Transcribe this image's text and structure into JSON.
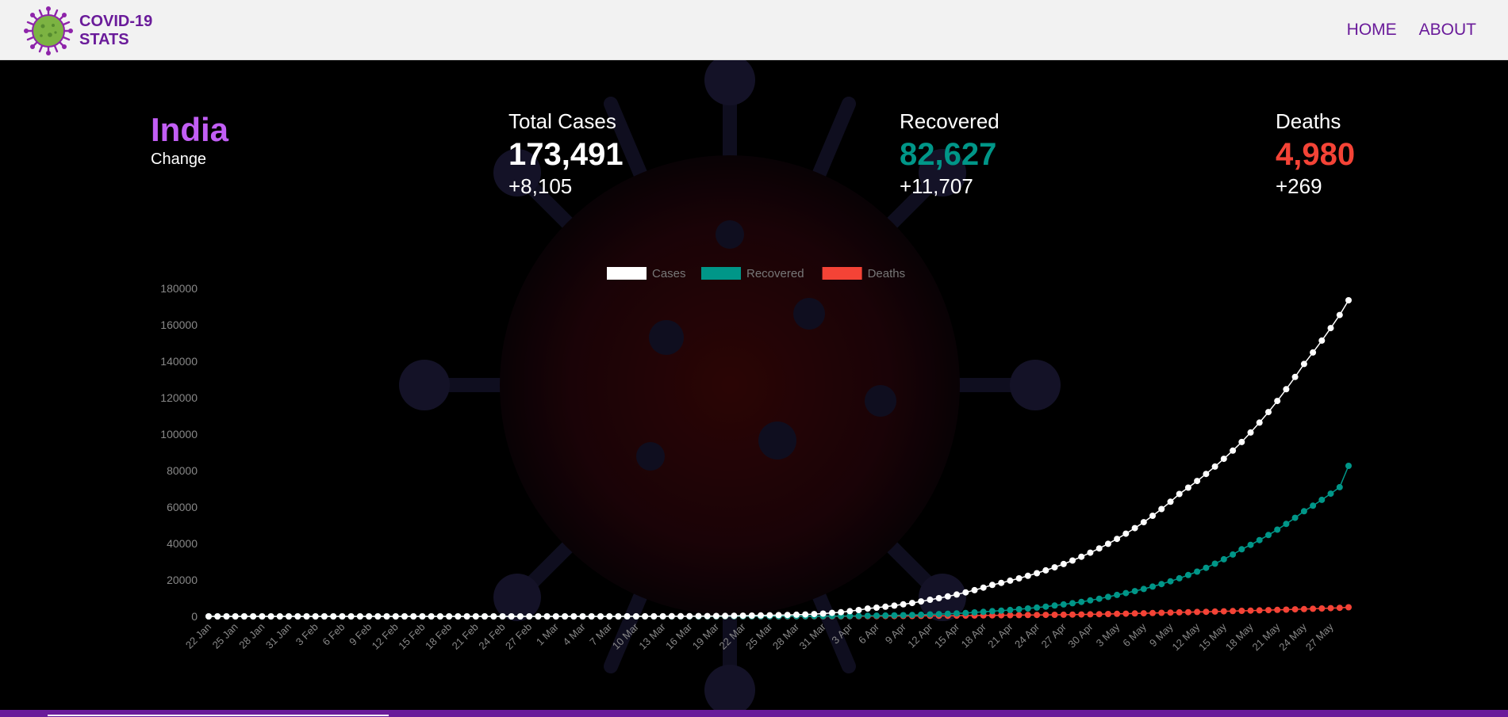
{
  "brand": {
    "line1": "COVID-19",
    "line2": "STATS"
  },
  "nav": {
    "home": "HOME",
    "about": "ABOUT"
  },
  "country": {
    "name": "India",
    "change_label": "Change"
  },
  "stats": {
    "cases": {
      "label": "Total Cases",
      "value": "173,491",
      "delta": "+8,105"
    },
    "recovered": {
      "label": "Recovered",
      "value": "82,627",
      "delta": "+11,707"
    },
    "deaths": {
      "label": "Deaths",
      "value": "4,980",
      "delta": "+269"
    }
  },
  "colors": {
    "brand": "#6a1b9a",
    "country": "#c25ef5",
    "cases": "#ffffff",
    "recovered": "#009688",
    "deaths": "#f44336"
  },
  "chart_data": {
    "type": "line",
    "legend_position": "top",
    "ylim": [
      0,
      180000
    ],
    "yticks": [
      0,
      20000,
      40000,
      60000,
      80000,
      100000,
      120000,
      140000,
      160000,
      180000
    ],
    "x_start": "2020-01-22",
    "x_end": "2020-05-29",
    "xtick_labels": [
      "22 Jan",
      "25 Jan",
      "28 Jan",
      "31 Jan",
      "3 Feb",
      "6 Feb",
      "9 Feb",
      "12 Feb",
      "15 Feb",
      "18 Feb",
      "21 Feb",
      "24 Feb",
      "27 Feb",
      "1 Mar",
      "4 Mar",
      "7 Mar",
      "10 Mar",
      "13 Mar",
      "16 Mar",
      "19 Mar",
      "22 Mar",
      "25 Mar",
      "28 Mar",
      "31 Mar",
      "3 Apr",
      "6 Apr",
      "9 Apr",
      "12 Apr",
      "15 Apr",
      "18 Apr",
      "21 Apr",
      "24 Apr",
      "27 Apr",
      "30 Apr",
      "3 May",
      "6 May",
      "9 May",
      "12 May",
      "15 May",
      "18 May",
      "21 May",
      "24 May",
      "27 May"
    ],
    "series": [
      {
        "name": "Cases",
        "color": "#ffffff",
        "points": [
          [
            "2020-01-22",
            0
          ],
          [
            "2020-03-01",
            3
          ],
          [
            "2020-03-15",
            107
          ],
          [
            "2020-03-22",
            396
          ],
          [
            "2020-03-29",
            1024
          ],
          [
            "2020-04-05",
            4288
          ],
          [
            "2020-04-12",
            9152
          ],
          [
            "2020-04-19",
            17265
          ],
          [
            "2020-04-26",
            26917
          ],
          [
            "2020-05-03",
            42505
          ],
          [
            "2020-05-10",
            67161
          ],
          [
            "2020-05-17",
            95698
          ],
          [
            "2020-05-24",
            138536
          ],
          [
            "2020-05-28",
            165386
          ],
          [
            "2020-05-29",
            173491
          ]
        ]
      },
      {
        "name": "Recovered",
        "color": "#009688",
        "points": [
          [
            "2020-01-22",
            0
          ],
          [
            "2020-03-15",
            10
          ],
          [
            "2020-03-29",
            95
          ],
          [
            "2020-04-05",
            328
          ],
          [
            "2020-04-12",
            1080
          ],
          [
            "2020-04-19",
            2854
          ],
          [
            "2020-04-26",
            5939
          ],
          [
            "2020-05-03",
            11775
          ],
          [
            "2020-05-10",
            20917
          ],
          [
            "2020-05-17",
            36824
          ],
          [
            "2020-05-24",
            57692
          ],
          [
            "2020-05-28",
            70920
          ],
          [
            "2020-05-29",
            82627
          ]
        ]
      },
      {
        "name": "Deaths",
        "color": "#f44336",
        "points": [
          [
            "2020-01-22",
            0
          ],
          [
            "2020-03-15",
            2
          ],
          [
            "2020-03-29",
            27
          ],
          [
            "2020-04-05",
            118
          ],
          [
            "2020-04-12",
            308
          ],
          [
            "2020-04-19",
            559
          ],
          [
            "2020-04-26",
            872
          ],
          [
            "2020-05-03",
            1391
          ],
          [
            "2020-05-10",
            2212
          ],
          [
            "2020-05-17",
            3029
          ],
          [
            "2020-05-24",
            4021
          ],
          [
            "2020-05-28",
            4711
          ],
          [
            "2020-05-29",
            4980
          ]
        ]
      }
    ]
  }
}
